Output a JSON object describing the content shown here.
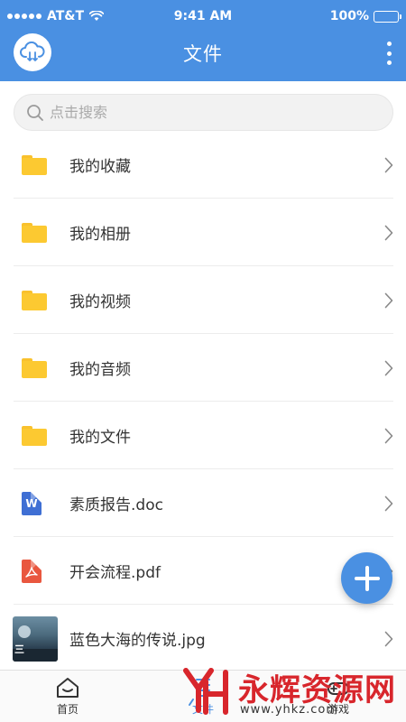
{
  "status_bar": {
    "carrier": "AT&T",
    "time": "9:41 AM",
    "battery": "100%"
  },
  "header": {
    "title": "文件",
    "logo_icon": "cloud-download-icon",
    "menu_icon": "more-vertical-icon"
  },
  "search": {
    "placeholder": "点击搜索",
    "icon": "search-icon"
  },
  "files": [
    {
      "name": "我的收藏",
      "type": "folder"
    },
    {
      "name": "我的相册",
      "type": "folder"
    },
    {
      "name": "我的视频",
      "type": "folder"
    },
    {
      "name": "我的音频",
      "type": "folder"
    },
    {
      "name": "我的文件",
      "type": "folder"
    },
    {
      "name": "素质报告.doc",
      "type": "word"
    },
    {
      "name": "开会流程.pdf",
      "type": "pdf"
    },
    {
      "name": "蓝色大海的传说.jpg",
      "type": "image"
    }
  ],
  "fab": {
    "icon": "plus-icon"
  },
  "tabbar": {
    "tabs": [
      {
        "label": "首页",
        "icon": "home-icon",
        "active": false
      },
      {
        "label": "文件",
        "icon": "file-list-icon",
        "active": true
      },
      {
        "label": "游戏",
        "icon": "game-icon",
        "active": false
      }
    ]
  },
  "watermark": {
    "text": "永辉资源网",
    "url": "www.yhkz.com"
  },
  "colors": {
    "primary": "#4a90e2",
    "folder": "#fcc931",
    "word": "#3f6fd4",
    "pdf": "#e9573f",
    "watermark": "#d8262c"
  }
}
